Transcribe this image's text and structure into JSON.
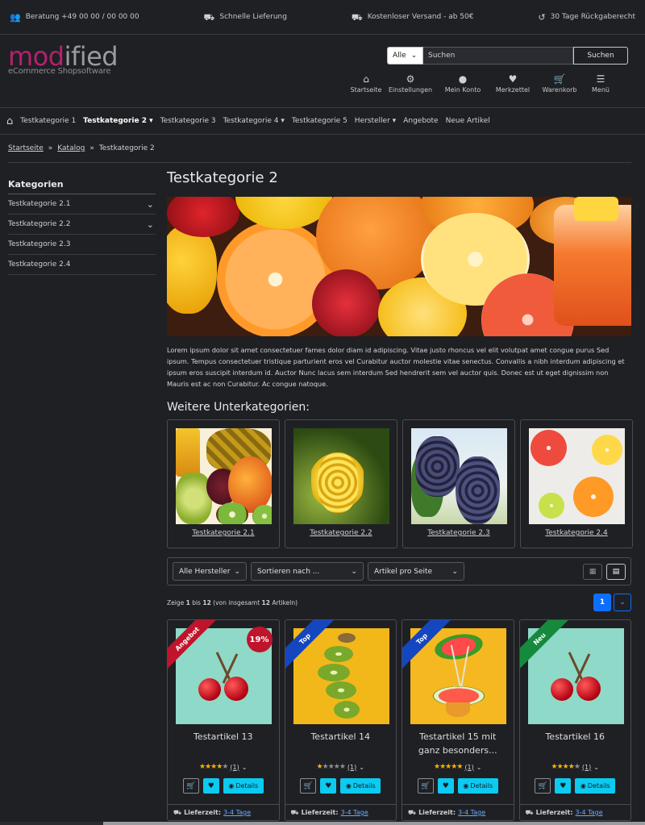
{
  "topbar": {
    "advice": "Beratung +49 00 00 / 00 00 00",
    "delivery": "Schnelle Lieferung",
    "shipping": "Kostenloser Versand - ab 50€",
    "returns": "30 Tage Rückgaberecht"
  },
  "logo": {
    "brand_a": "mod",
    "brand_b": "ified",
    "tagline": "eCommerce Shopsoftware"
  },
  "search": {
    "scope": "Alle",
    "placeholder": "Suchen",
    "button": "Suchen"
  },
  "header_nav": [
    {
      "label": "Startseite",
      "icon": "home-icon"
    },
    {
      "label": "Einstellungen",
      "icon": "gear-icon"
    },
    {
      "label": "Mein Konto",
      "icon": "user-icon"
    },
    {
      "label": "Merkzettel",
      "icon": "heart-icon"
    },
    {
      "label": "Warenkorb",
      "icon": "cart-icon"
    },
    {
      "label": "Menü",
      "icon": "menu-icon"
    }
  ],
  "main_nav": [
    "Testkategorie 1",
    "Testkategorie 2",
    "Testkategorie 3",
    "Testkategorie 4",
    "Testkategorie 5",
    "Hersteller",
    "Angebote",
    "Neue Artikel"
  ],
  "breadcrumb": [
    "Startseite",
    "Katalog",
    "Testkategorie 2"
  ],
  "sidebar": {
    "title": "Kategorien",
    "items": [
      "Testkategorie 2.1",
      "Testkategorie 2.2",
      "Testkategorie 2.3",
      "Testkategorie 2.4"
    ]
  },
  "page_title": "Testkategorie 2",
  "description": "Lorem ipsum dolor sit amet consectetuer fames dolor diam id adipiscing. Vitae justo rhoncus vel elit volutpat amet congue purus Sed ipsum. Tempus consectetuer tristique parturient eros vel Curabitur auctor molestie vitae senectus. Convallis a nibh interdum adipiscing et ipsum eros suscipit interdum id. Auctor Nunc lacus sem interdum Sed hendrerit sem vel auctor quis. Donec est ut eget dignissim non Mauris est ac non Curabitur. Ac congue natoque.",
  "subcat_heading": "Weitere Unterkategorien:",
  "subcats": [
    "Testkategorie 2.1",
    "Testkategorie 2.2",
    "Testkategorie 2.3",
    "Testkategorie 2.4"
  ],
  "filters": {
    "manufacturer": "Alle Hersteller",
    "sort": "Sortieren nach ...",
    "per_page": "Artikel pro Seite"
  },
  "pagination": {
    "show_a": "Zeige ",
    "from": "1",
    "show_b": " bis ",
    "to": "12",
    "show_c": " (von insgesamt ",
    "total": "12",
    "show_d": " Artikeln)",
    "current_page": "1",
    "next_icon": "chevron-down-icon"
  },
  "products": [
    {
      "name": "Testartikel 13",
      "ribbon": "Angebot",
      "ribbon_color": "#c0142c",
      "discount": "19%",
      "stars": 4,
      "count": "(1)"
    },
    {
      "name": "Testartikel 14",
      "ribbon": "Top",
      "ribbon_color": "#1446c0",
      "stars": 1,
      "count": "(1)"
    },
    {
      "name": "Testartikel 15 mit ganz besonders...",
      "ribbon": "Top",
      "ribbon_color": "#1446c0",
      "stars": 5,
      "count": "(1)"
    },
    {
      "name": "Testartikel 16",
      "ribbon": "Neu",
      "ribbon_color": "#168a3c",
      "stars": 4,
      "count": "(1)"
    }
  ],
  "details_label": "Details",
  "delivery": {
    "label": "Lieferzeit:",
    "value": "3-4 Tage"
  }
}
